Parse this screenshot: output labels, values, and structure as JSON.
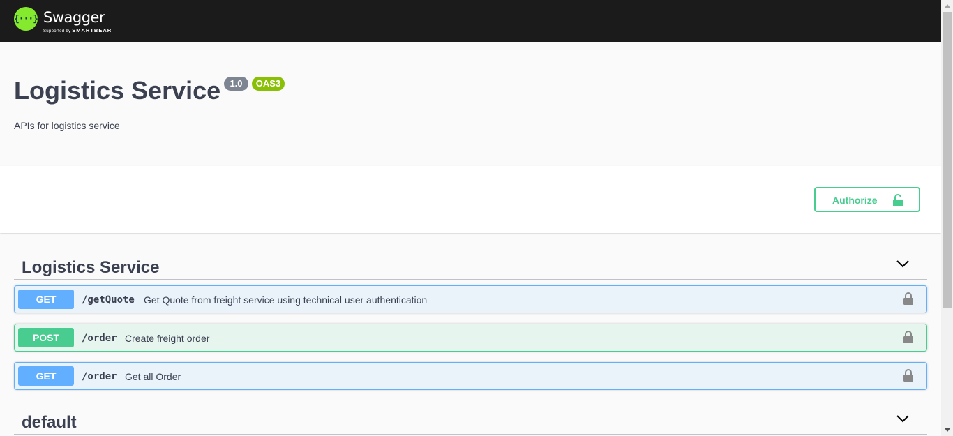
{
  "topbar": {
    "logo_glyph": "{···}",
    "logo_word": "Swagger",
    "logo_sub_prefix": "Supported by",
    "logo_sub_brand": "SMARTBEAR",
    "icon": "swagger-logo-icon"
  },
  "info": {
    "title": "Logistics Service",
    "version": "1.0",
    "oas_badge": "OAS3",
    "description": "APIs for logistics service"
  },
  "scheme": {
    "authorize_label": "Authorize",
    "authorize_icon": "lock-open-icon"
  },
  "tags": [
    {
      "name": "Logistics Service",
      "icon": "chevron-down-icon",
      "operations": [
        {
          "method": "GET",
          "path": "/getQuote",
          "summary": "Get Quote from freight service using technical user authentication",
          "icon": "lock-icon"
        },
        {
          "method": "POST",
          "path": "/order",
          "summary": "Create freight order",
          "icon": "lock-icon"
        },
        {
          "method": "GET",
          "path": "/order",
          "summary": "Get all Order",
          "icon": "lock-icon"
        }
      ]
    },
    {
      "name": "default",
      "icon": "chevron-down-icon"
    }
  ],
  "colors": {
    "get": "#61affe",
    "post": "#49cc90",
    "version_badge": "#7d8492",
    "oas_badge": "#89bf04",
    "topbar": "#1b1b1b",
    "logo_green": "#85ea2d"
  }
}
